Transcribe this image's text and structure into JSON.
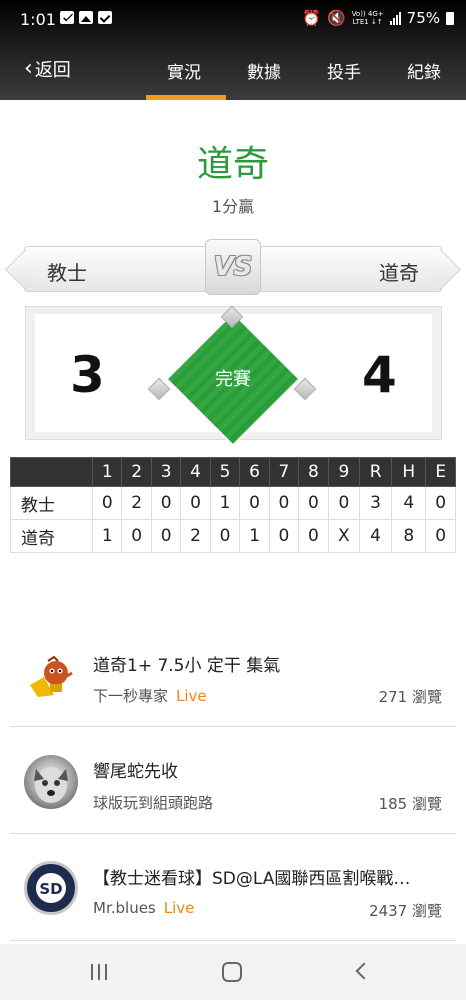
{
  "status": {
    "time": "1:01",
    "net_top": "Vo)) 4G+",
    "net_bottom": "LTE1 ↓↑",
    "battery": "75%"
  },
  "nav": {
    "back_label": "返回",
    "tabs": [
      "實況",
      "數據",
      "投手",
      "紀錄"
    ],
    "active_tab": "實況",
    "accent": "#f39a1e"
  },
  "result": {
    "winner": "道奇",
    "margin": "1分贏"
  },
  "matchup": {
    "away": "教士",
    "home": "道奇",
    "vs": "VS",
    "away_score": "3",
    "home_score": "4",
    "status": "完賽"
  },
  "linescore": {
    "headers": [
      "1",
      "2",
      "3",
      "4",
      "5",
      "6",
      "7",
      "8",
      "9",
      "R",
      "H",
      "E"
    ],
    "rows": [
      {
        "team": "教士",
        "cells": [
          "0",
          "2",
          "0",
          "0",
          "1",
          "0",
          "0",
          "0",
          "0",
          "3",
          "4",
          "0"
        ]
      },
      {
        "team": "道奇",
        "cells": [
          "1",
          "0",
          "0",
          "2",
          "0",
          "1",
          "0",
          "0",
          "X",
          "4",
          "8",
          "0"
        ]
      }
    ]
  },
  "posts": [
    {
      "title": "道奇1+ 7.5小  定干 集氣",
      "author": "下一秒專家",
      "live": "Live",
      "views": "271 瀏覽"
    },
    {
      "title": "響尾蛇先收",
      "author": "球版玩到組頭跑路",
      "live": "",
      "views": "185 瀏覽"
    },
    {
      "title": "【教士迷看球】SD@LA國聯西區割喉戰…",
      "author": "Mr.blues",
      "live": "Live",
      "views": "2437 瀏覽"
    }
  ],
  "colors": {
    "winner_green": "#2c9a3c",
    "live_orange": "#f0861c"
  }
}
